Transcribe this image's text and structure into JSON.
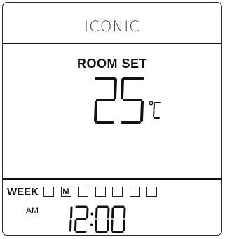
{
  "brand": {
    "name": "ICONIC"
  },
  "display": {
    "mode_label": "ROOM SET",
    "temperature": "25",
    "unit": "℃",
    "week_label": "WEEK",
    "days": [
      "",
      "M",
      "",
      "",
      "",
      "",
      ""
    ],
    "active_day": "M",
    "ampm": "AM",
    "time": "12:00"
  },
  "colors": {
    "segment": "#111111",
    "frame": "#2a2a2a",
    "background": "#ffffff"
  }
}
